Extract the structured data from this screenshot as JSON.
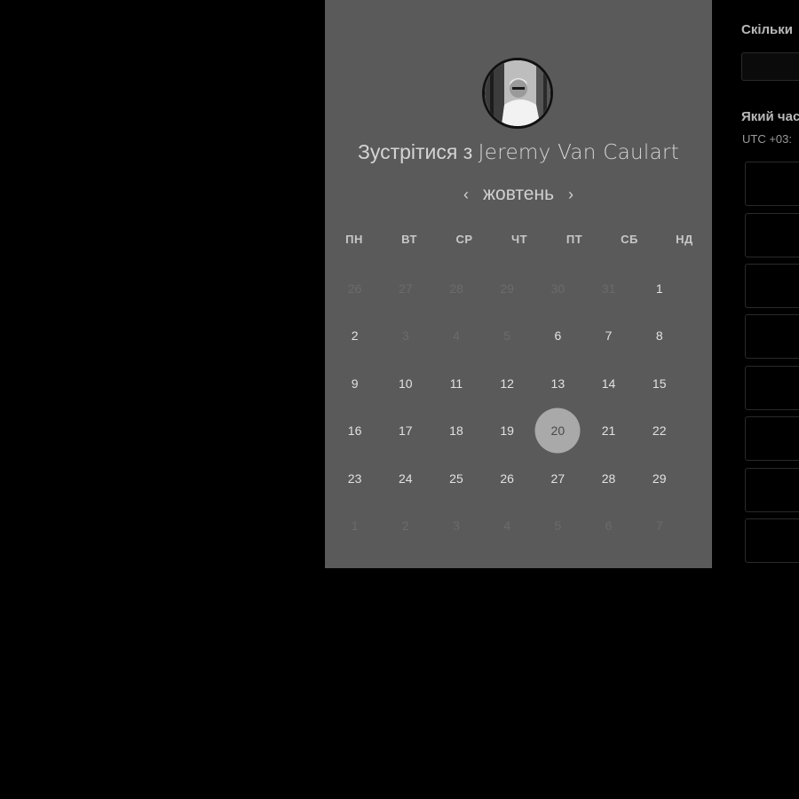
{
  "host": {
    "title_prefix": "Зустрітися з",
    "name": "Jeremy Van Caulart"
  },
  "calendar": {
    "month": "жовтень",
    "prev_icon": "chevron-left-icon",
    "next_icon": "chevron-right-icon",
    "weekdays": [
      "ПН",
      "ВТ",
      "СР",
      "ЧТ",
      "ПТ",
      "СБ",
      "НД"
    ],
    "selected_day": "20",
    "days": [
      {
        "label": "26",
        "state": "disabled"
      },
      {
        "label": "27",
        "state": "disabled"
      },
      {
        "label": "28",
        "state": "disabled"
      },
      {
        "label": "29",
        "state": "disabled"
      },
      {
        "label": "30",
        "state": "disabled"
      },
      {
        "label": "31",
        "state": "disabled"
      },
      {
        "label": "1",
        "state": "active"
      },
      {
        "label": "2",
        "state": "active"
      },
      {
        "label": "3",
        "state": "disabled"
      },
      {
        "label": "4",
        "state": "disabled"
      },
      {
        "label": "5",
        "state": "disabled"
      },
      {
        "label": "6",
        "state": "active"
      },
      {
        "label": "7",
        "state": "active"
      },
      {
        "label": "8",
        "state": "active"
      },
      {
        "label": "9",
        "state": "active"
      },
      {
        "label": "10",
        "state": "active"
      },
      {
        "label": "11",
        "state": "active"
      },
      {
        "label": "12",
        "state": "active"
      },
      {
        "label": "13",
        "state": "active"
      },
      {
        "label": "14",
        "state": "active"
      },
      {
        "label": "15",
        "state": "active"
      },
      {
        "label": "16",
        "state": "active"
      },
      {
        "label": "17",
        "state": "active"
      },
      {
        "label": "18",
        "state": "active"
      },
      {
        "label": "19",
        "state": "active"
      },
      {
        "label": "20",
        "state": "selected"
      },
      {
        "label": "21",
        "state": "active"
      },
      {
        "label": "22",
        "state": "active"
      },
      {
        "label": "23",
        "state": "active"
      },
      {
        "label": "24",
        "state": "active"
      },
      {
        "label": "25",
        "state": "active"
      },
      {
        "label": "26",
        "state": "active"
      },
      {
        "label": "27",
        "state": "active"
      },
      {
        "label": "28",
        "state": "active"
      },
      {
        "label": "29",
        "state": "active"
      },
      {
        "label": "1",
        "state": "disabled"
      },
      {
        "label": "2",
        "state": "disabled"
      },
      {
        "label": "3",
        "state": "disabled"
      },
      {
        "label": "4",
        "state": "disabled"
      },
      {
        "label": "5",
        "state": "disabled"
      },
      {
        "label": "6",
        "state": "disabled"
      },
      {
        "label": "7",
        "state": "disabled"
      }
    ]
  },
  "booking": {
    "duration_label": "Скільки",
    "time_label": "Який час",
    "timezone": "UTC +03:"
  },
  "colors": {
    "backdrop": "#000000",
    "panel": "#5a5a5a",
    "selected_circle": "#a9a9a9"
  }
}
